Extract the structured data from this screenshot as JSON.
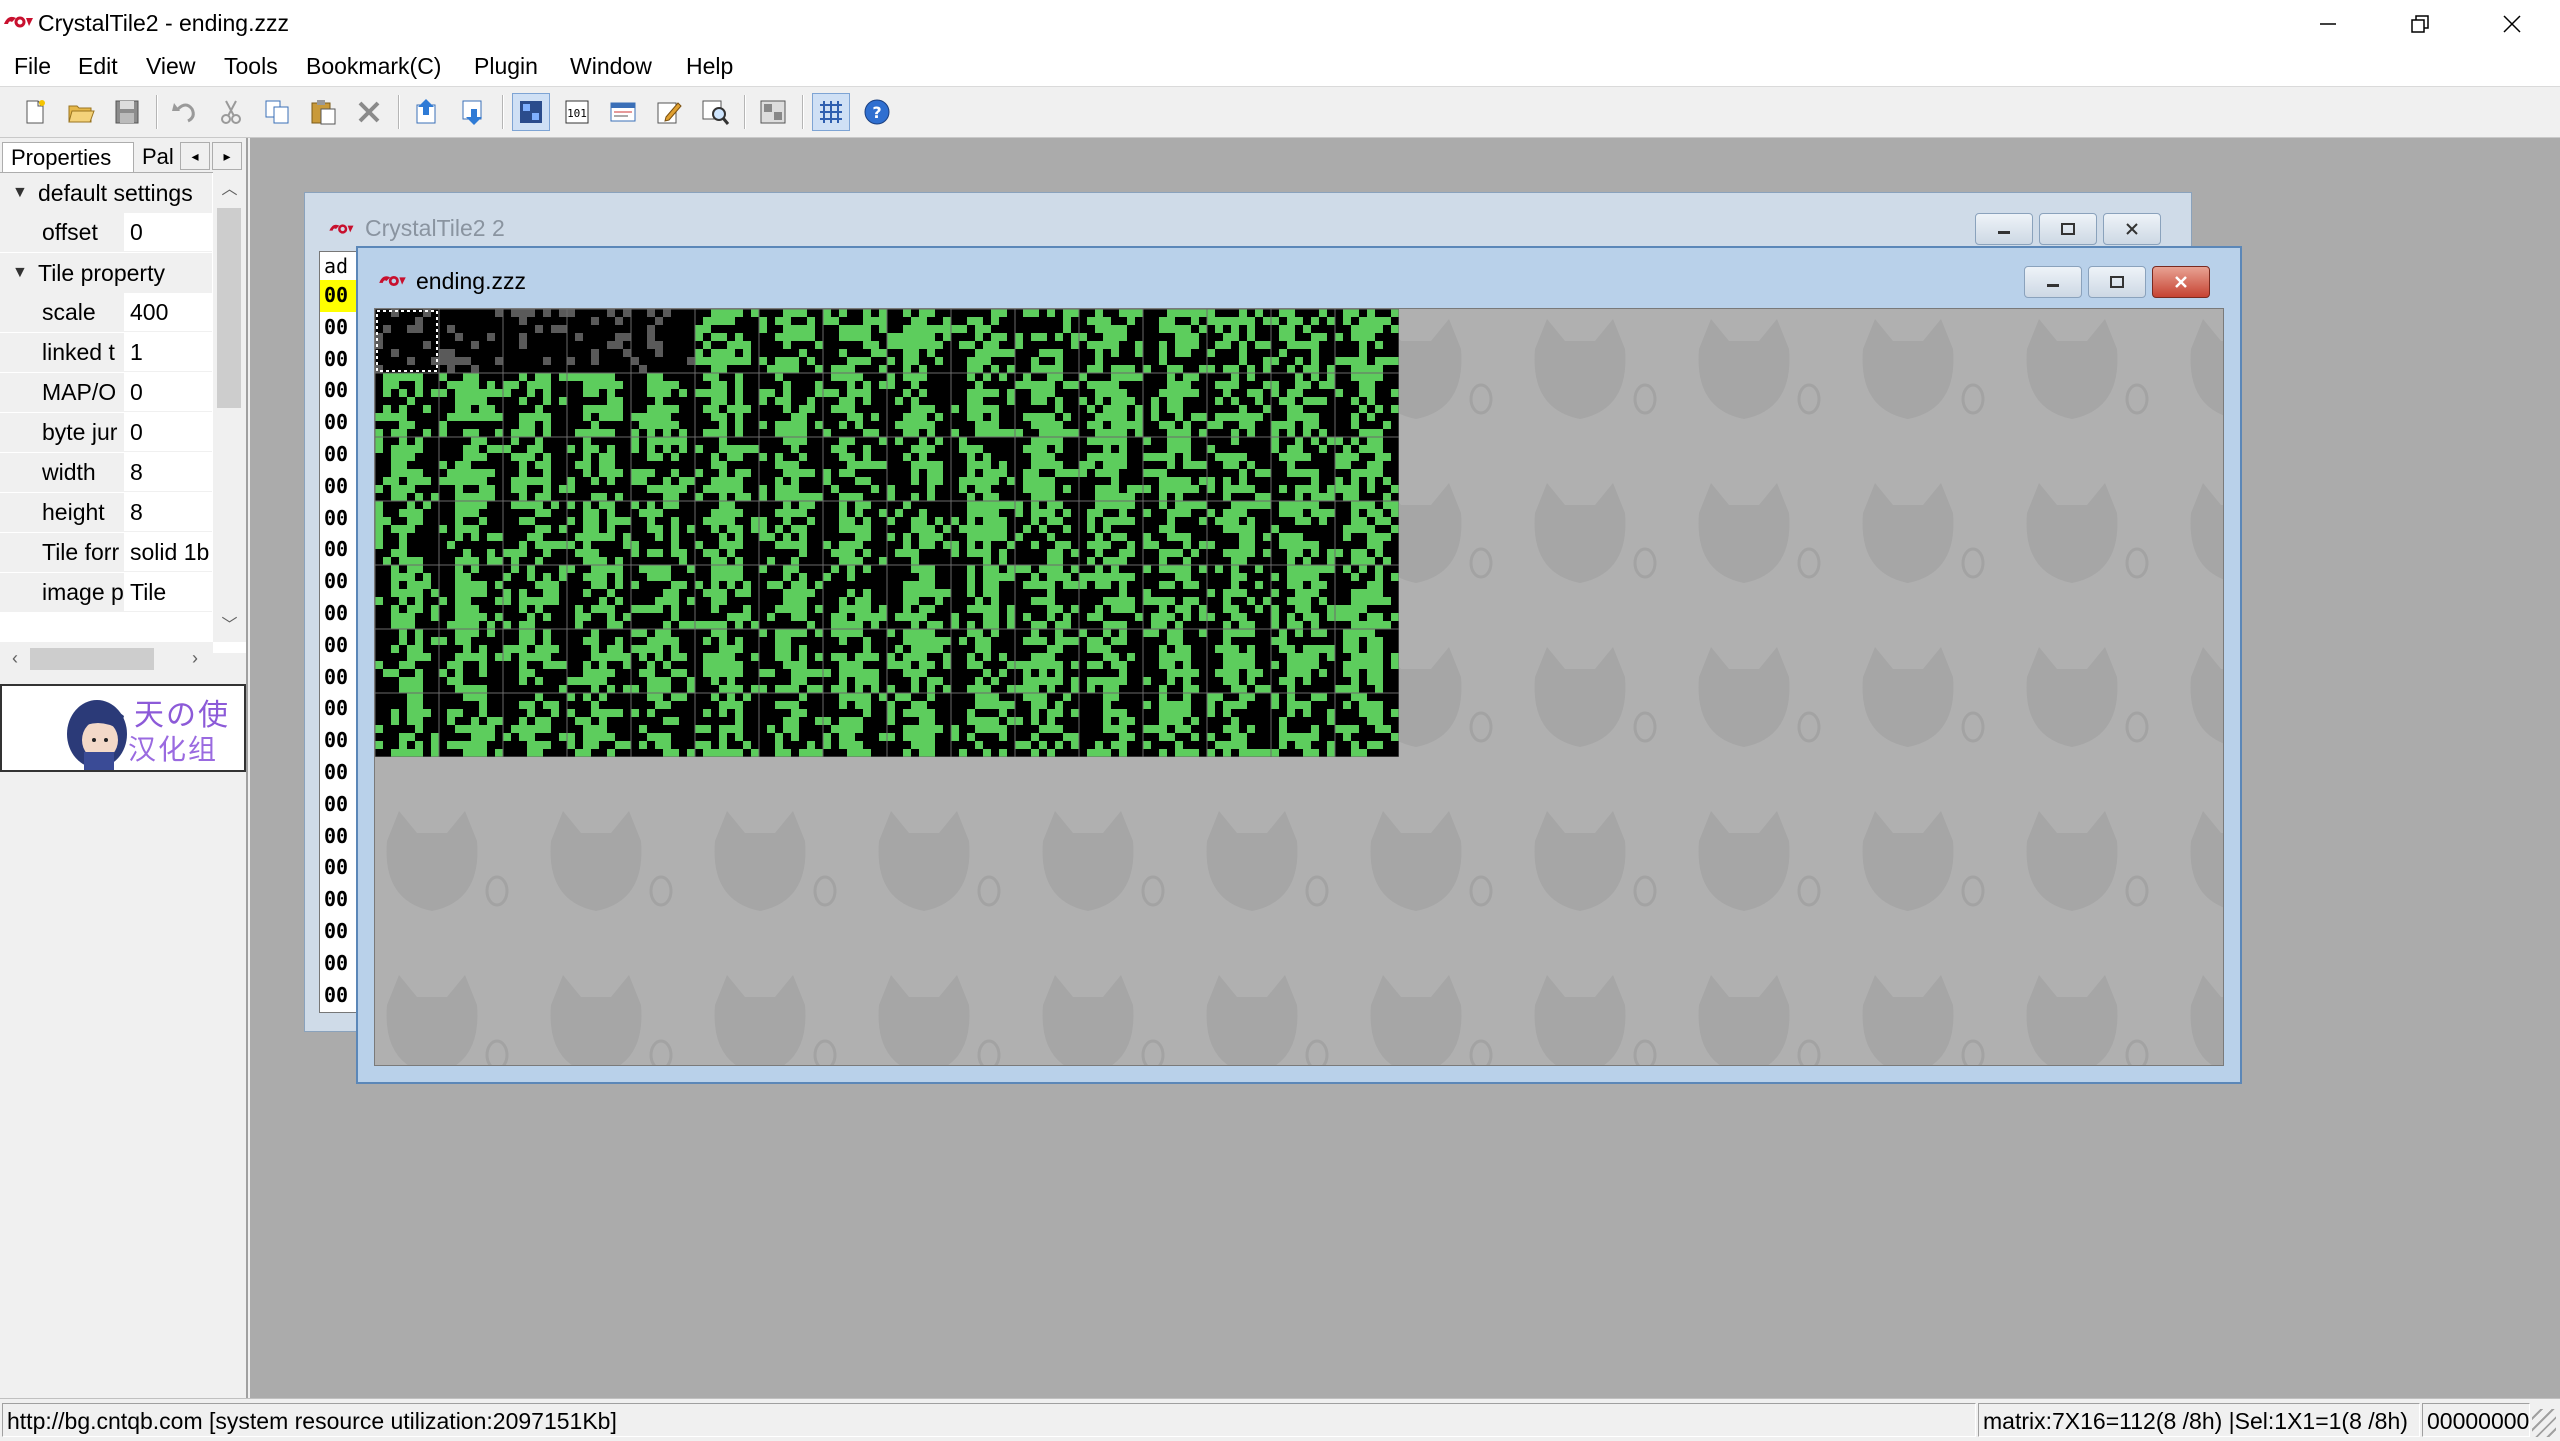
{
  "window": {
    "title": "CrystalTile2 - ending.zzz"
  },
  "menu": [
    "File",
    "Edit",
    "View",
    "Tools",
    "Bookmark(C)",
    "Plugin",
    "Window",
    "Help"
  ],
  "toolbar": {
    "buttons": [
      "new-file",
      "open-file",
      "save",
      "undo",
      "cut",
      "copy",
      "paste",
      "delete",
      "import",
      "export",
      "tile-view",
      "hex-view",
      "text-view",
      "edit",
      "search",
      "screenshot",
      "grid",
      "help"
    ]
  },
  "left_panel": {
    "tabs": [
      "Properties",
      "Pal"
    ],
    "categories": {
      "default_settings": "default settings",
      "tile_property": "Tile property"
    },
    "rows": {
      "offset": {
        "name": "offset",
        "value": "0"
      },
      "scale": {
        "name": "scale",
        "value": "400"
      },
      "linked": {
        "name": "linked t",
        "value": "1"
      },
      "mapo": {
        "name": "MAP/O",
        "value": "0"
      },
      "bytejump": {
        "name": "byte jur",
        "value": "0"
      },
      "width": {
        "name": "width",
        "value": "8"
      },
      "height": {
        "name": "height",
        "value": "8"
      },
      "tileformat": {
        "name": "Tile forr",
        "value": "solid 1b"
      },
      "imagep": {
        "name": "image p",
        "value": "Tile"
      }
    },
    "logo": {
      "line1": "天の使",
      "line2": "汉化组"
    }
  },
  "back_window": {
    "title": "CrystalTile2 2",
    "addr_header": "ad",
    "addr_prefix": "00"
  },
  "front_window": {
    "title": "ending.zzz"
  },
  "tile_grid": {
    "cols": 16,
    "rows": 7,
    "green": "#5dcd5d",
    "black": "#000000"
  },
  "status": {
    "url": "http://bg.cntqb.com [system resource utilization:2097151Kb]",
    "matrix": "matrix:7X16=112(8 /8h) |Sel:1X1=1(8 /8h)",
    "offset": "00000000"
  }
}
